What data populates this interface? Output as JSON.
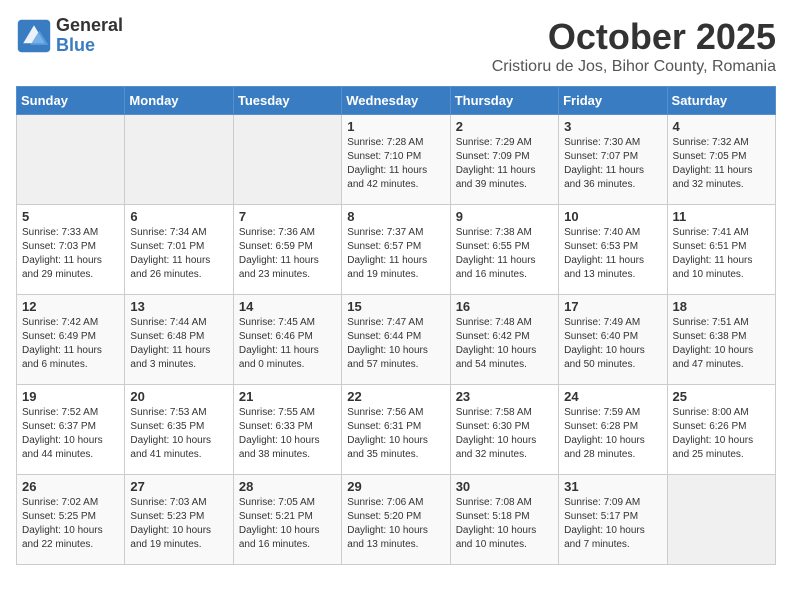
{
  "logo": {
    "general": "General",
    "blue": "Blue"
  },
  "header": {
    "month": "October 2025",
    "location": "Cristioru de Jos, Bihor County, Romania"
  },
  "weekdays": [
    "Sunday",
    "Monday",
    "Tuesday",
    "Wednesday",
    "Thursday",
    "Friday",
    "Saturday"
  ],
  "weeks": [
    [
      {
        "day": "",
        "info": ""
      },
      {
        "day": "",
        "info": ""
      },
      {
        "day": "",
        "info": ""
      },
      {
        "day": "1",
        "info": "Sunrise: 7:28 AM\nSunset: 7:10 PM\nDaylight: 11 hours\nand 42 minutes."
      },
      {
        "day": "2",
        "info": "Sunrise: 7:29 AM\nSunset: 7:09 PM\nDaylight: 11 hours\nand 39 minutes."
      },
      {
        "day": "3",
        "info": "Sunrise: 7:30 AM\nSunset: 7:07 PM\nDaylight: 11 hours\nand 36 minutes."
      },
      {
        "day": "4",
        "info": "Sunrise: 7:32 AM\nSunset: 7:05 PM\nDaylight: 11 hours\nand 32 minutes."
      }
    ],
    [
      {
        "day": "5",
        "info": "Sunrise: 7:33 AM\nSunset: 7:03 PM\nDaylight: 11 hours\nand 29 minutes."
      },
      {
        "day": "6",
        "info": "Sunrise: 7:34 AM\nSunset: 7:01 PM\nDaylight: 11 hours\nand 26 minutes."
      },
      {
        "day": "7",
        "info": "Sunrise: 7:36 AM\nSunset: 6:59 PM\nDaylight: 11 hours\nand 23 minutes."
      },
      {
        "day": "8",
        "info": "Sunrise: 7:37 AM\nSunset: 6:57 PM\nDaylight: 11 hours\nand 19 minutes."
      },
      {
        "day": "9",
        "info": "Sunrise: 7:38 AM\nSunset: 6:55 PM\nDaylight: 11 hours\nand 16 minutes."
      },
      {
        "day": "10",
        "info": "Sunrise: 7:40 AM\nSunset: 6:53 PM\nDaylight: 11 hours\nand 13 minutes."
      },
      {
        "day": "11",
        "info": "Sunrise: 7:41 AM\nSunset: 6:51 PM\nDaylight: 11 hours\nand 10 minutes."
      }
    ],
    [
      {
        "day": "12",
        "info": "Sunrise: 7:42 AM\nSunset: 6:49 PM\nDaylight: 11 hours\nand 6 minutes."
      },
      {
        "day": "13",
        "info": "Sunrise: 7:44 AM\nSunset: 6:48 PM\nDaylight: 11 hours\nand 3 minutes."
      },
      {
        "day": "14",
        "info": "Sunrise: 7:45 AM\nSunset: 6:46 PM\nDaylight: 11 hours\nand 0 minutes."
      },
      {
        "day": "15",
        "info": "Sunrise: 7:47 AM\nSunset: 6:44 PM\nDaylight: 10 hours\nand 57 minutes."
      },
      {
        "day": "16",
        "info": "Sunrise: 7:48 AM\nSunset: 6:42 PM\nDaylight: 10 hours\nand 54 minutes."
      },
      {
        "day": "17",
        "info": "Sunrise: 7:49 AM\nSunset: 6:40 PM\nDaylight: 10 hours\nand 50 minutes."
      },
      {
        "day": "18",
        "info": "Sunrise: 7:51 AM\nSunset: 6:38 PM\nDaylight: 10 hours\nand 47 minutes."
      }
    ],
    [
      {
        "day": "19",
        "info": "Sunrise: 7:52 AM\nSunset: 6:37 PM\nDaylight: 10 hours\nand 44 minutes."
      },
      {
        "day": "20",
        "info": "Sunrise: 7:53 AM\nSunset: 6:35 PM\nDaylight: 10 hours\nand 41 minutes."
      },
      {
        "day": "21",
        "info": "Sunrise: 7:55 AM\nSunset: 6:33 PM\nDaylight: 10 hours\nand 38 minutes."
      },
      {
        "day": "22",
        "info": "Sunrise: 7:56 AM\nSunset: 6:31 PM\nDaylight: 10 hours\nand 35 minutes."
      },
      {
        "day": "23",
        "info": "Sunrise: 7:58 AM\nSunset: 6:30 PM\nDaylight: 10 hours\nand 32 minutes."
      },
      {
        "day": "24",
        "info": "Sunrise: 7:59 AM\nSunset: 6:28 PM\nDaylight: 10 hours\nand 28 minutes."
      },
      {
        "day": "25",
        "info": "Sunrise: 8:00 AM\nSunset: 6:26 PM\nDaylight: 10 hours\nand 25 minutes."
      }
    ],
    [
      {
        "day": "26",
        "info": "Sunrise: 7:02 AM\nSunset: 5:25 PM\nDaylight: 10 hours\nand 22 minutes."
      },
      {
        "day": "27",
        "info": "Sunrise: 7:03 AM\nSunset: 5:23 PM\nDaylight: 10 hours\nand 19 minutes."
      },
      {
        "day": "28",
        "info": "Sunrise: 7:05 AM\nSunset: 5:21 PM\nDaylight: 10 hours\nand 16 minutes."
      },
      {
        "day": "29",
        "info": "Sunrise: 7:06 AM\nSunset: 5:20 PM\nDaylight: 10 hours\nand 13 minutes."
      },
      {
        "day": "30",
        "info": "Sunrise: 7:08 AM\nSunset: 5:18 PM\nDaylight: 10 hours\nand 10 minutes."
      },
      {
        "day": "31",
        "info": "Sunrise: 7:09 AM\nSunset: 5:17 PM\nDaylight: 10 hours\nand 7 minutes."
      },
      {
        "day": "",
        "info": ""
      }
    ]
  ]
}
